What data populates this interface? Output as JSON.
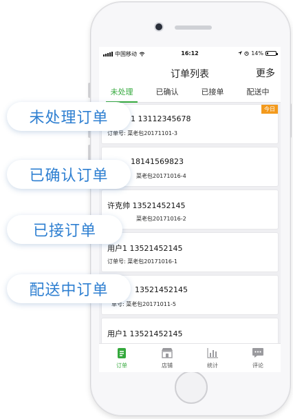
{
  "status": {
    "carrier": "中国移动",
    "time": "16:12",
    "battery": "14%",
    "battery_level": 0.14
  },
  "nav": {
    "title": "订单列表",
    "more": "更多"
  },
  "tabs": [
    "未处理",
    "已确认",
    "已接单",
    "配送中"
  ],
  "active_tab": 0,
  "orders": [
    {
      "name": "1 13112345678",
      "order": "订单号: 菜老包20171101-3",
      "badge": "今日"
    },
    {
      "name": "18141569823",
      "order": "菜老包20171016-4",
      "badge": ""
    },
    {
      "name": "许克帅 13521452145",
      "order": "菜老包20171016-2",
      "badge": ""
    },
    {
      "name": "用户1 13521452145",
      "order": "订单号: 菜老包20171016-1",
      "badge": ""
    },
    {
      "name": "13521452145",
      "order": "单号: 菜老包20171011-5",
      "badge": ""
    },
    {
      "name": "用户1 13521452145",
      "order": "",
      "badge": ""
    }
  ],
  "tabbar": [
    {
      "label": "订单",
      "icon": "order-icon"
    },
    {
      "label": "店铺",
      "icon": "store-icon"
    },
    {
      "label": "统计",
      "icon": "stats-icon"
    },
    {
      "label": "评论",
      "icon": "comment-icon"
    }
  ],
  "callouts": [
    "未处理订单",
    "已确认订单",
    "已接订单",
    "配送中订单"
  ],
  "colors": {
    "accent": "#35a93d",
    "badge": "#f39a1d",
    "callout_text": "#2e7fd1"
  }
}
